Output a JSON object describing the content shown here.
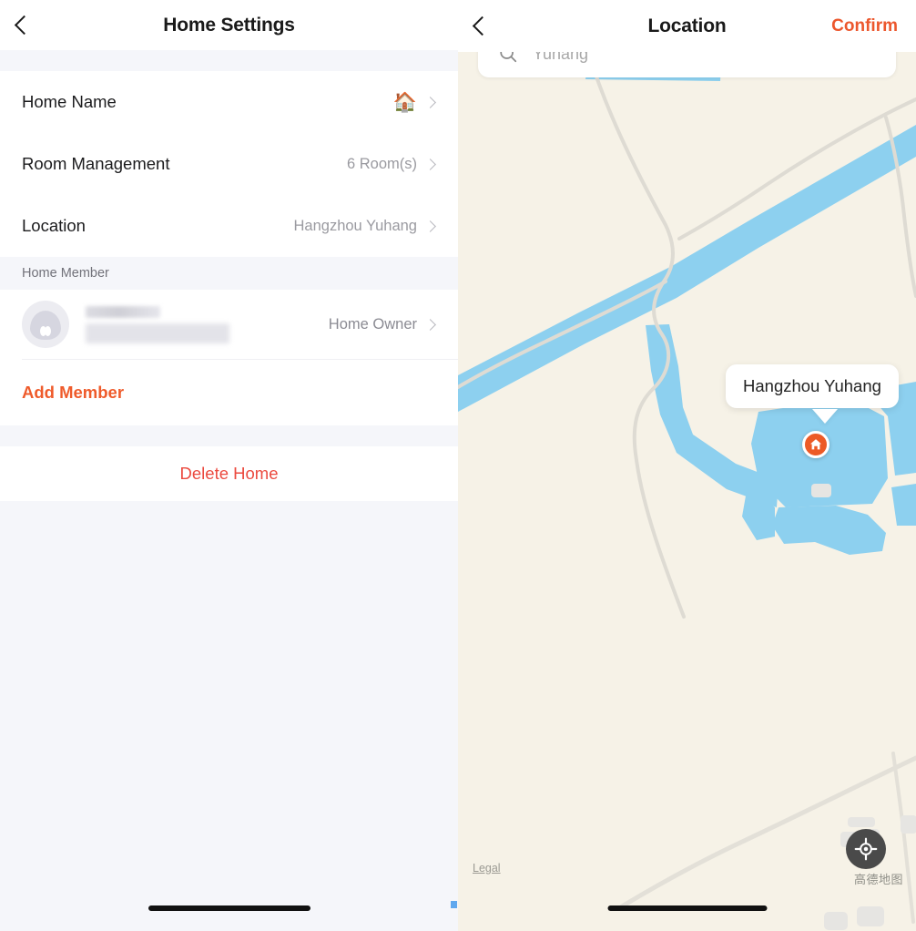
{
  "colors": {
    "accent_orange": "#ef5b2b",
    "confirm_orange": "#ec572d",
    "delete_red": "#eb4a3f",
    "pin_orange": "#ec5a26",
    "panel_bg": "#f5f6fa",
    "map_land": "#f6f2e7",
    "map_water": "#8dd0ef",
    "map_road": "#dedbd3",
    "map_building": "#e6e5e2"
  },
  "settings_screen": {
    "nav": {
      "back_icon": "chevron-left-icon",
      "title": "Home Settings"
    },
    "rows": [
      {
        "label": "Home Name",
        "value": "",
        "emoji": "🏠",
        "chevron": true
      },
      {
        "label": "Room Management",
        "value": "6 Room(s)",
        "emoji": "",
        "chevron": true
      },
      {
        "label": "Location",
        "value": "Hangzhou  Yuhang",
        "emoji": "",
        "chevron": true
      }
    ],
    "member_section": {
      "header": "Home Member",
      "member": {
        "name_redacted": "",
        "sub_redacted": "",
        "role": "Home Owner",
        "avatar_icon": "user-avatar-icon"
      },
      "add_member_label": "Add Member"
    },
    "delete_label": "Delete Home"
  },
  "location_screen": {
    "nav": {
      "back_icon": "chevron-left-icon",
      "title": "Location",
      "confirm_label": "Confirm"
    },
    "search": {
      "icon": "search-icon",
      "value": "",
      "placeholder": "Yuhang"
    },
    "map": {
      "callout_label": "Hangzhou Yuhang",
      "pin_icon": "home-pin-icon",
      "legal_label": "Legal",
      "locate_icon": "locate-crosshair-icon",
      "attribution": "高德地图"
    }
  }
}
